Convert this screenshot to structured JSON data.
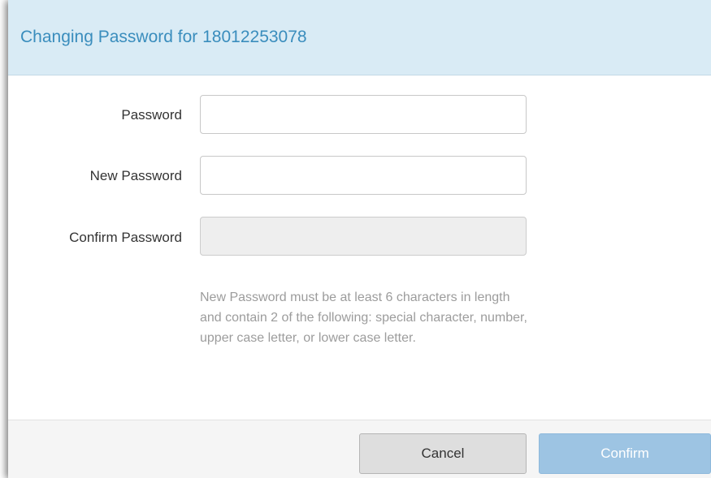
{
  "dialog": {
    "title": "Changing Password for 18012253078"
  },
  "form": {
    "password_label": "Password",
    "password_value": "",
    "new_password_label": "New Password",
    "new_password_value": "",
    "confirm_password_label": "Confirm Password",
    "confirm_password_value": "",
    "confirm_password_disabled": true,
    "help_text": "New Password must be at least 6 characters in length and contain 2 of the following: special character, number, upper case letter, or lower case letter."
  },
  "footer": {
    "cancel_label": "Cancel",
    "confirm_label": "Confirm",
    "confirm_disabled": true
  },
  "colors": {
    "header_background": "#d9ebf5",
    "title_color": "#3a8dbd",
    "confirm_button": "#9dc4e3",
    "cancel_button": "#dedede",
    "help_text": "#9c9c9c"
  }
}
